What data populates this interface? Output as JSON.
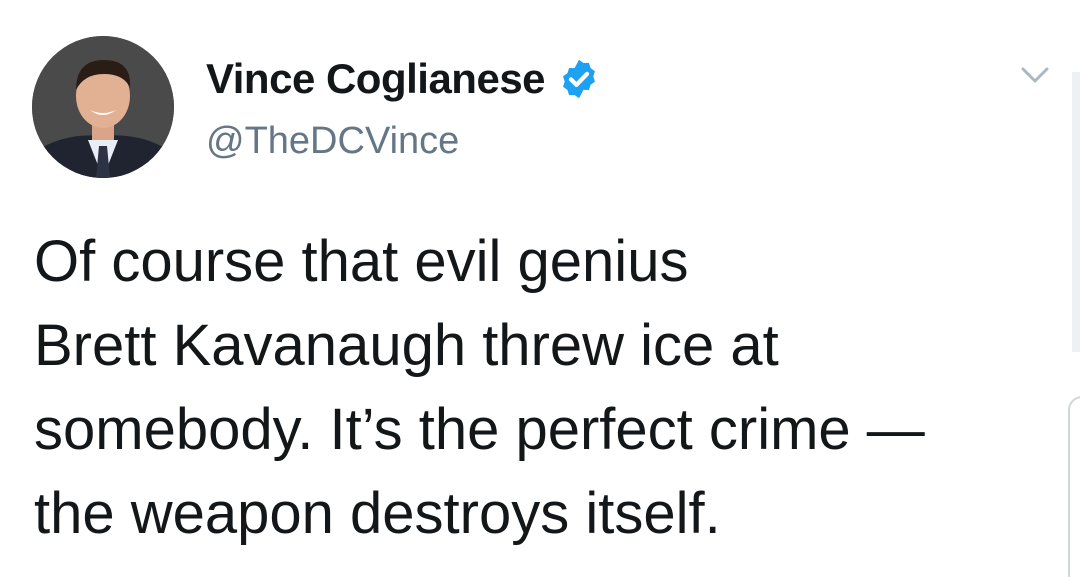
{
  "author": {
    "display_name": "Vince Coglianese",
    "handle": "@TheDCVince",
    "verified": true,
    "verified_color": "#1da1f2"
  },
  "tweet": {
    "text": "Of course that evil genius\nBrett Kavanaugh threw ice at\nsomebody. It’s the perfect crime —\nthe weapon destroys itself."
  },
  "icons": {
    "avatar": "profile-photo",
    "verified": "verified-badge-icon",
    "menu": "chevron-down-icon"
  },
  "colors": {
    "text": "#14171a",
    "secondary_text": "#657786",
    "background": "#ffffff"
  }
}
